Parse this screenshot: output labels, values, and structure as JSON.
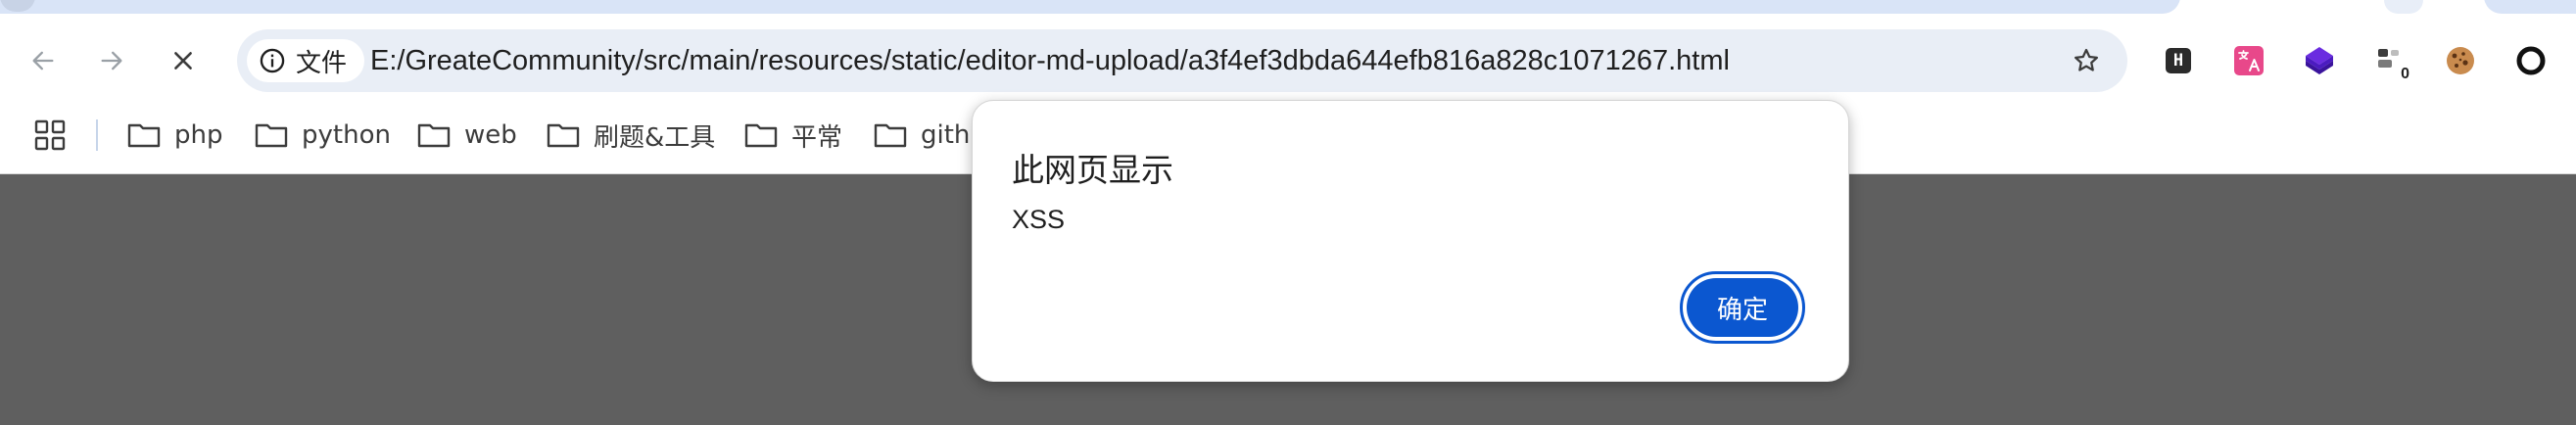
{
  "browser": {
    "address_bar": {
      "chip_label": "文件",
      "url": "E:/GreateCommunity/src/main/resources/static/editor-md-upload/a3f4ef3dbda644efb816a828c1071267.html"
    },
    "extensions": {
      "h_label": "H",
      "counter_badge": "0"
    },
    "bookmarks": [
      {
        "label": "php"
      },
      {
        "label": "python"
      },
      {
        "label": "web"
      },
      {
        "label": "刷题&工具"
      },
      {
        "label": "平常"
      },
      {
        "label": "githu"
      }
    ]
  },
  "dialog": {
    "title": "此网页显示",
    "message": "XSS",
    "ok_label": "确定"
  },
  "colors": {
    "accent": "#0b57d0",
    "page_background": "#5f5f5f",
    "omnibox": "#e9eef6"
  }
}
